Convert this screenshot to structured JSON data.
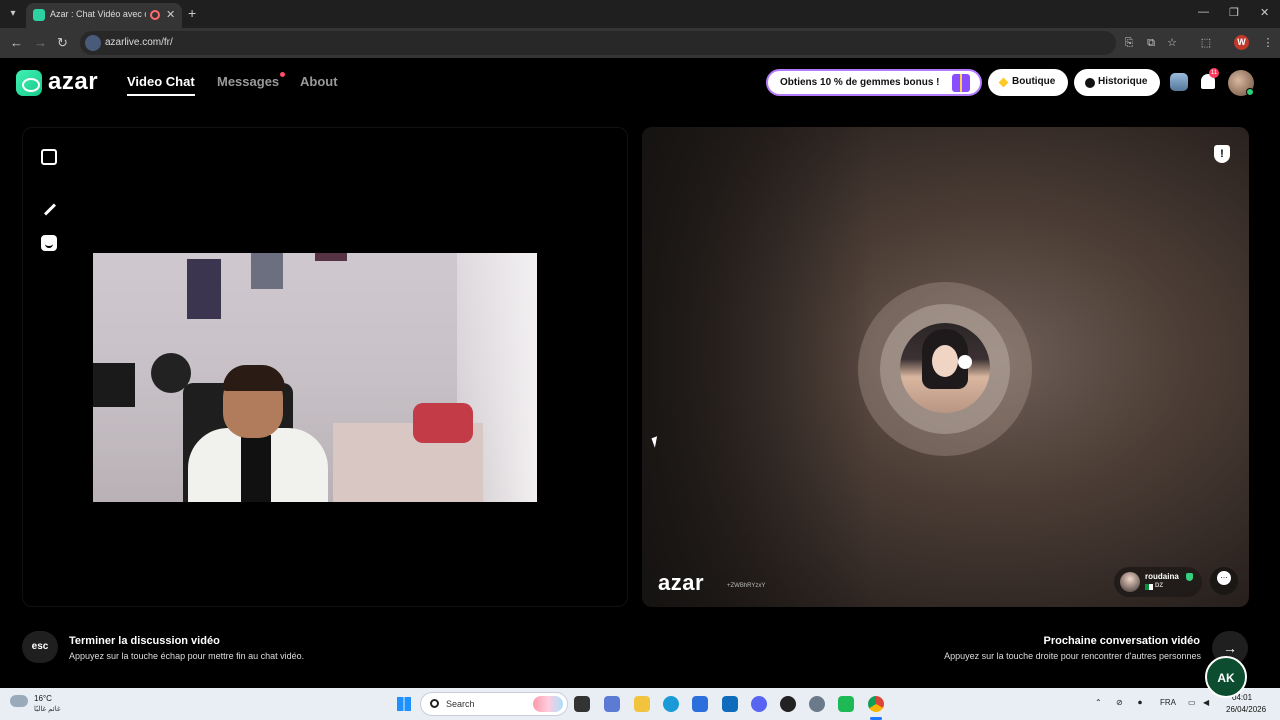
{
  "browser": {
    "tab_title": "Azar : Chat Vidéo avec de",
    "tab_close": "✕",
    "new_tab": "+",
    "url": "azarlive.com/fr/",
    "profile_initial": "W",
    "window_controls": [
      "—",
      "❐",
      "✕"
    ]
  },
  "header": {
    "logo_text": "azar",
    "nav": [
      {
        "label": "Video Chat",
        "active": true
      },
      {
        "label": "Messages",
        "has_notification": true
      },
      {
        "label": "About"
      }
    ],
    "promo_label": "Obtiens 10 % de gemmes bonus !",
    "shop_label": "Boutique",
    "history_label": "Historique",
    "notification_count": "11"
  },
  "remote": {
    "watermark_logo": "azar",
    "watermark_id": "+ZWBhRYzxY",
    "partner_name": "roudaina",
    "partner_country": "DZ"
  },
  "footer": {
    "esc_key": "esc",
    "end_title": "Terminer la discussion vidéo",
    "end_subtitle": "Appuyez sur la touche échap pour mettre fin au chat vidéo.",
    "next_title": "Prochaine conversation vidéo",
    "next_subtitle": "Appuyez sur la touche droite pour rencontrer d'autres personnes",
    "next_arrow": "→"
  },
  "taskbar": {
    "temperature": "16°C",
    "weather_desc": "غائم غالبًا",
    "search_placeholder": "Search",
    "language": "FRA",
    "time": "04:01",
    "date": "26/04/2026"
  },
  "overlay": {
    "badge_text": "AK"
  },
  "colors": {
    "brand": "#2ed1a2",
    "promo_border": "#b57bff",
    "notification": "#ff3b5c"
  }
}
